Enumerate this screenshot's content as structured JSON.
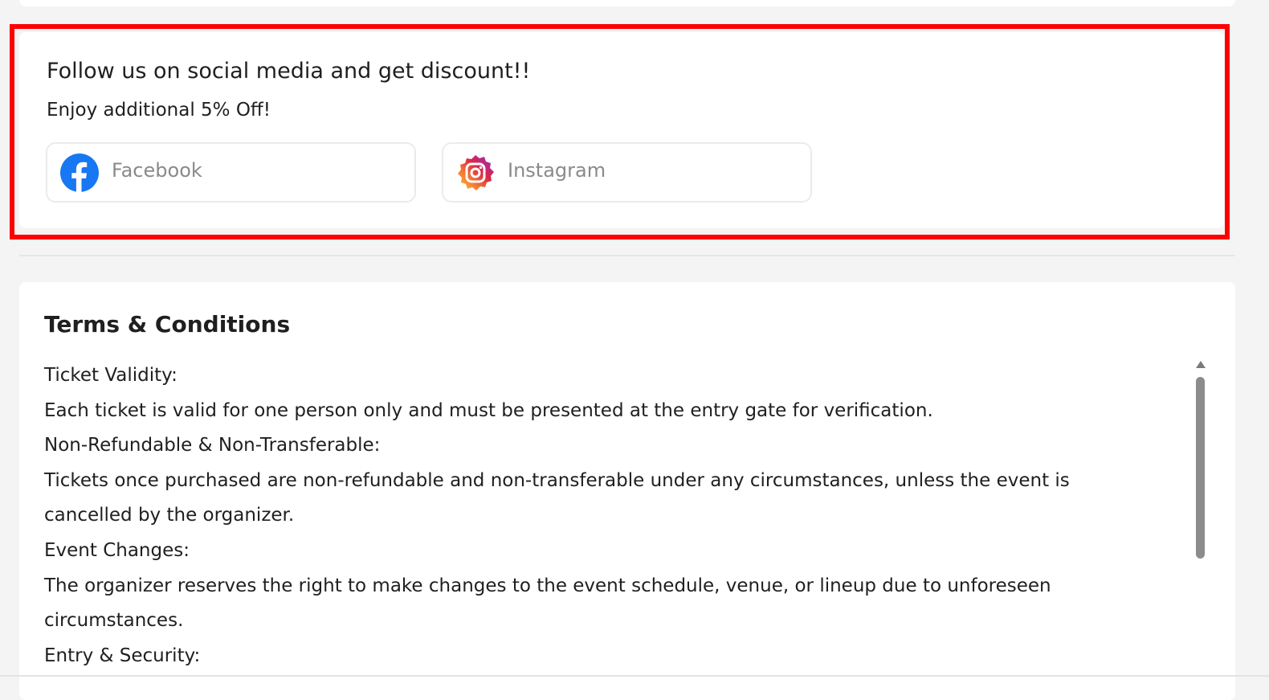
{
  "social": {
    "title": "Follow us on social media and get discount!!",
    "subtitle": "Enjoy additional 5% Off!",
    "buttons": [
      {
        "label": "Facebook",
        "icon": "facebook-icon",
        "color": "#1877f2"
      },
      {
        "label": "Instagram",
        "icon": "instagram-icon",
        "color": "#dc2743"
      }
    ],
    "highlight_color": "#ff0000"
  },
  "terms": {
    "title": "Terms & Conditions",
    "paragraphs": [
      "Ticket Validity:",
      "Each ticket is valid for one person only and must be presented at the entry gate for verification.",
      "Non-Refundable & Non-Transferable:",
      "Tickets once purchased are non-refundable and non-transferable under any circumstances, unless the event is cancelled by the organizer.",
      "Event Changes:",
      "The organizer reserves the right to make changes to the event schedule, venue, or lineup due to unforeseen circumstances.",
      "Entry & Security:"
    ]
  }
}
